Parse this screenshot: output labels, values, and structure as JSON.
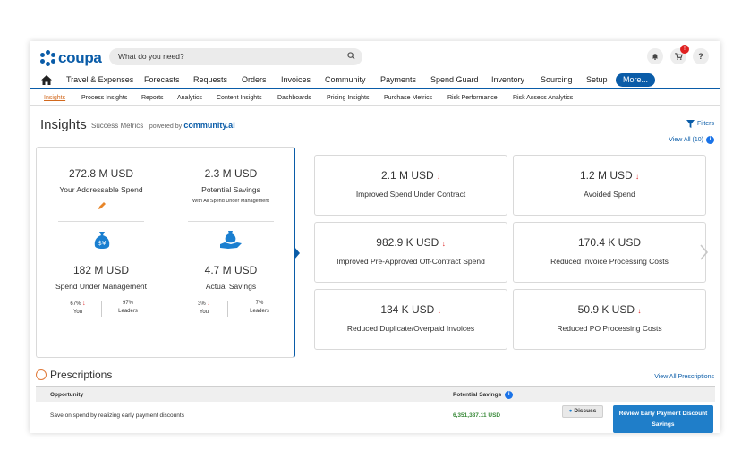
{
  "header": {
    "logo_text": "coupa",
    "search_placeholder": "What do you need?",
    "cart_badge": "!",
    "help_label": "?"
  },
  "nav": {
    "items": [
      "Travel & Expenses",
      "Forecasts",
      "Requests",
      "Orders",
      "Invoices",
      "Community",
      "Payments",
      "Spend Guard",
      "Inventory",
      "Sourcing",
      "Setup"
    ],
    "more_label": "More..."
  },
  "subnav": {
    "items": [
      "Insights",
      "Process Insights",
      "Reports",
      "Analytics",
      "Content Insights",
      "Dashboards",
      "Pricing Insights",
      "Purchase Metrics",
      "Risk Performance",
      "Risk Assess Analytics"
    ],
    "active": "Insights"
  },
  "page": {
    "title": "Insights",
    "subtitle": "Success Metrics",
    "powered_by": "powered by",
    "powered_brand": "community.ai",
    "filters_label": "Filters",
    "view_all_label": "View All (10)"
  },
  "summary": {
    "addressable_value": "272.8 M USD",
    "addressable_label": "Your Addressable Spend",
    "potential_value": "2.3 M USD",
    "potential_label": "Potential Savings",
    "potential_note": "With All Spend Under Management",
    "sum_value": "182 M USD",
    "sum_label": "Spend Under Management",
    "sum_you": "67%",
    "sum_leaders": "97%",
    "actual_value": "4.7 M USD",
    "actual_label": "Actual Savings",
    "actual_you": "3%",
    "actual_leaders": "7%",
    "you_label": "You",
    "leaders_label": "Leaders"
  },
  "tiles": [
    {
      "value": "2.1 M USD",
      "label": "Improved Spend Under Contract",
      "down": true
    },
    {
      "value": "1.2 M USD",
      "label": "Avoided Spend",
      "down": true
    },
    {
      "value": "982.9 K USD",
      "label": "Improved Pre-Approved Off-Contract Spend",
      "down": true
    },
    {
      "value": "170.4 K USD",
      "label": "Reduced Invoice Processing Costs",
      "down": false
    },
    {
      "value": "134 K USD",
      "label": "Reduced Duplicate/Overpaid Invoices",
      "down": true
    },
    {
      "value": "50.9 K USD",
      "label": "Reduced PO Processing Costs",
      "down": true
    }
  ],
  "prescriptions": {
    "title": "Prescriptions",
    "view_all": "View All Prescriptions",
    "col_opportunity": "Opportunity",
    "col_savings": "Potential Savings",
    "row_opportunity": "Save on spend by realizing early payment discounts",
    "row_savings": "6,351,387.11 USD",
    "discuss_label": "Discuss",
    "review_label": "Review Early Payment Discount Savings"
  },
  "colors": {
    "brand": "#0a5ca8",
    "accent_orange": "#d2691e",
    "down_red": "#dd2222",
    "savings_green": "#3a8a3a"
  }
}
